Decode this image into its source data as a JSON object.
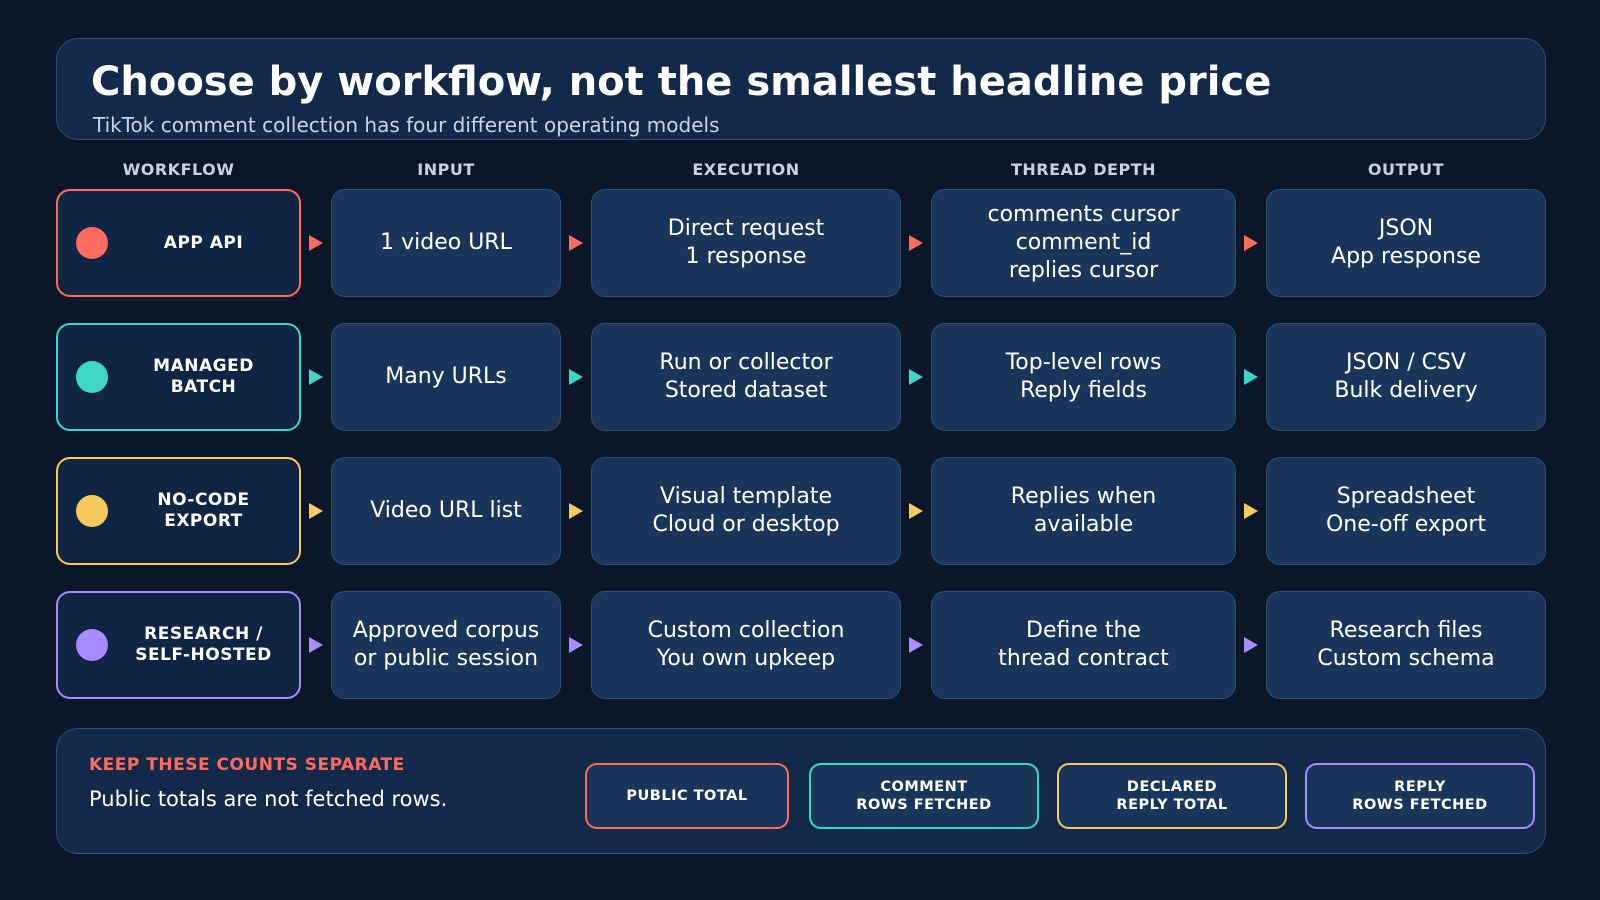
{
  "header": {
    "title": "Choose by workflow, not the smallest headline price",
    "subtitle": "TikTok comment collection has four different operating models"
  },
  "columns": [
    "WORKFLOW",
    "INPUT",
    "EXECUTION",
    "THREAD DEPTH",
    "OUTPUT"
  ],
  "rows": [
    {
      "workflow": "APP API",
      "color": "#ff6b5e",
      "input": "1 video URL",
      "execution": "Direct request\n1 response",
      "thread_depth": "comments cursor\ncomment_id\nreplies cursor",
      "output": "JSON\nApp response"
    },
    {
      "workflow": "MANAGED\nBATCH",
      "color": "#3ed6c4",
      "input": "Many URLs",
      "execution": "Run or collector\nStored dataset",
      "thread_depth": "Top-level rows\nReply fields",
      "output": "JSON / CSV\nBulk delivery"
    },
    {
      "workflow": "NO-CODE\nEXPORT",
      "color": "#f8cc5c",
      "input": "Video URL list",
      "execution": "Visual template\nCloud or desktop",
      "thread_depth": "Replies when\navailable",
      "output": "Spreadsheet\nOne-off export"
    },
    {
      "workflow": "RESEARCH /\nSELF-HOSTED",
      "color": "#a78bff",
      "input": "Approved corpus\nor public session",
      "execution": "Custom collection\nYou own upkeep",
      "thread_depth": "Define the\nthread contract",
      "output": "Research files\nCustom schema"
    }
  ],
  "footer": {
    "title": "KEEP THESE COUNTS SEPARATE",
    "note": "Public totals are not fetched rows.",
    "pills": [
      {
        "label": "PUBLIC TOTAL",
        "color": "#ff6b5e"
      },
      {
        "label": "COMMENT\nROWS FETCHED",
        "color": "#3ed6c4"
      },
      {
        "label": "DECLARED\nREPLY TOTAL",
        "color": "#f8cc5c"
      },
      {
        "label": "REPLY\nROWS FETCHED",
        "color": "#a78bff"
      }
    ]
  },
  "colors": {
    "background": "#0b1628",
    "card": "#1a355a",
    "border": "#2e4e74",
    "accent_red": "#ff6b5e",
    "accent_teal": "#3ed6c4",
    "accent_yellow": "#f8cc5c",
    "accent_purple": "#a78bff"
  }
}
